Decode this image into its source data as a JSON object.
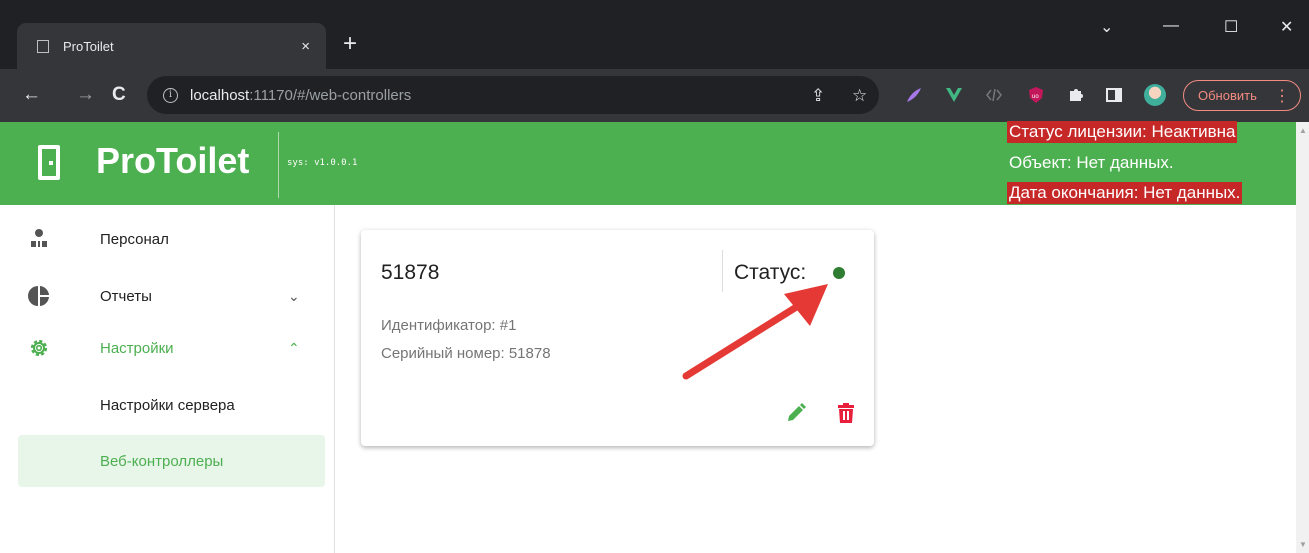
{
  "browser": {
    "tab_title": "ProToilet",
    "tab_close": "×",
    "new_tab": "+",
    "url_host": "localhost",
    "url_rest": ":11170/#/web-controllers",
    "update_label": "Обновить",
    "update_menu": "⋮",
    "window_controls": {
      "collapse": "⌄",
      "minimize": "—",
      "maximize": "☐",
      "close": "✕"
    },
    "nav": {
      "back": "←",
      "forward": "→",
      "reload": "C"
    },
    "omnibox_info": "i",
    "share_icon": "⇪",
    "bookmark_icon": "☆",
    "extensions": [
      "feather-icon",
      "vue-icon",
      "code-icon",
      "ublock-icon",
      "puzzle-icon",
      "sidepanel-icon"
    ]
  },
  "app": {
    "title": "ProToilet",
    "version": "sys: v1.0.0.1",
    "license_status": "Статус лицензии: Неактивна",
    "object": "Объект: Нет данных.",
    "expiry": "Дата окончания: Нет данных.",
    "header_color": "#4caf50",
    "alert_color": "#c62828"
  },
  "sidebar": {
    "items": [
      {
        "label": "Персонал",
        "icon": "personnel-icon"
      },
      {
        "label": "Отчеты",
        "icon": "pie-chart-icon",
        "chevron": "⌄"
      },
      {
        "label": "Настройки",
        "icon": "gear-icon",
        "chevron": "⌃"
      },
      {
        "label": "Настройки сервера"
      },
      {
        "label": "Веб-контроллеры",
        "active": true
      }
    ]
  },
  "card": {
    "title": "51878",
    "status_label": "Статус:",
    "status_color": "#2e7d32",
    "identifier": "Идентификатор: #1",
    "serial": "Серийный номер: 51878",
    "edit_icon": "pencil-icon",
    "delete_icon": "trash-icon"
  }
}
